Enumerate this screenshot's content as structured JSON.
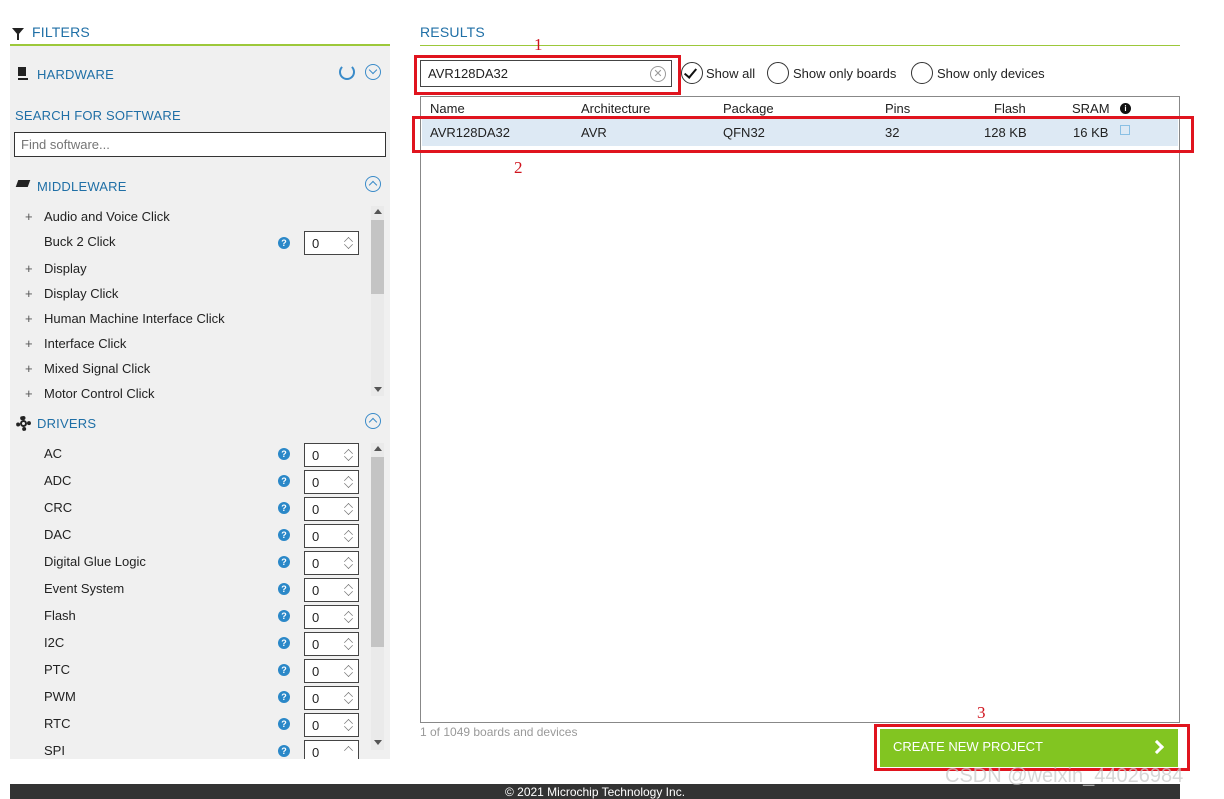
{
  "filters": {
    "title": "FILTERS",
    "hardware": {
      "label": "HARDWARE"
    },
    "software_search": {
      "label": "SEARCH FOR SOFTWARE",
      "placeholder": "Find software..."
    },
    "middleware": {
      "label": "MIDDLEWARE",
      "items": [
        {
          "label": "Audio and Voice Click",
          "expand": "+"
        },
        {
          "label": "Buck 2 Click",
          "count": "0"
        },
        {
          "label": "Display",
          "expand": "+"
        },
        {
          "label": "Display Click",
          "expand": "+"
        },
        {
          "label": "Human Machine Interface Click",
          "expand": "+"
        },
        {
          "label": "Interface Click",
          "expand": "+"
        },
        {
          "label": "Mixed Signal Click",
          "expand": "+"
        },
        {
          "label": "Motor Control Click",
          "expand": "+"
        }
      ]
    },
    "drivers": {
      "label": "DRIVERS",
      "items": [
        {
          "label": "AC",
          "count": "0"
        },
        {
          "label": "ADC",
          "count": "0"
        },
        {
          "label": "CRC",
          "count": "0"
        },
        {
          "label": "DAC",
          "count": "0"
        },
        {
          "label": "Digital Glue Logic",
          "count": "0"
        },
        {
          "label": "Event System",
          "count": "0"
        },
        {
          "label": "Flash",
          "count": "0"
        },
        {
          "label": "I2C",
          "count": "0"
        },
        {
          "label": "PTC",
          "count": "0"
        },
        {
          "label": "PWM",
          "count": "0"
        },
        {
          "label": "RTC",
          "count": "0"
        },
        {
          "label": "SPI",
          "count": "0"
        }
      ]
    }
  },
  "results": {
    "title": "RESULTS",
    "search_value": "AVR128DA32",
    "options": {
      "show_all": "Show all",
      "show_boards": "Show only boards",
      "show_devices": "Show only devices"
    },
    "selected_option": "show_all",
    "columns": [
      "Name",
      "Architecture",
      "Package",
      "Pins",
      "Flash",
      "SRAM"
    ],
    "rows": [
      {
        "name": "AVR128DA32",
        "architecture": "AVR",
        "package": "QFN32",
        "pins": "32",
        "flash": "128 KB",
        "sram": "16 KB"
      }
    ],
    "count_text": "1 of 1049 boards and devices",
    "create_button": "CREATE NEW PROJECT"
  },
  "annotations": [
    "1",
    "2",
    "3"
  ],
  "footer": "© 2021 Microchip Technology Inc.",
  "watermark": "CSDN @weixin_44026984",
  "colors": {
    "accent_green": "#82c521",
    "link_blue": "#1f6fa6",
    "annotation_red": "#e0141e",
    "row_selected": "#dde9f4"
  }
}
